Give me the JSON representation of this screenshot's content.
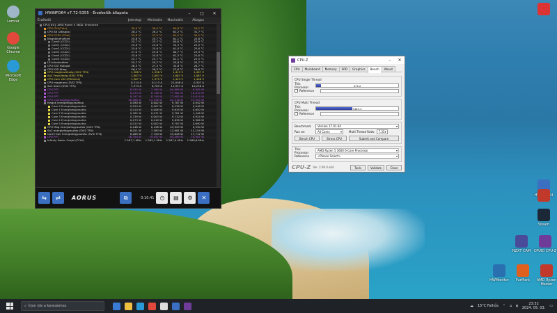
{
  "desktop": {
    "left_icons": [
      {
        "label": "Lomtár",
        "color": "#9fb6c8"
      },
      {
        "label": "Google Chrome",
        "color": "#e0493b"
      },
      {
        "label": "Microsoft Edge",
        "color": "#2a9ad6"
      }
    ],
    "right_icons": [
      {
        "label": "",
        "color": "#d33"
      },
      {
        "label": "HWiNFO64",
        "color": "#3b6fc1"
      },
      {
        "label": "",
        "color": "#c0392b"
      },
      {
        "label": "Steam",
        "color": "#1b2838"
      },
      {
        "label": "NZXT CAM",
        "color": "#4a4a9a"
      },
      {
        "label": "CPUID CPU-Z",
        "color": "#6f3c9a"
      },
      {
        "label": "HWMonitor",
        "color": "#2a6fb0"
      },
      {
        "label": "FurMark",
        "color": "#e06020"
      },
      {
        "label": "AMD Ryzen Master",
        "color": "#c0392b"
      }
    ]
  },
  "hwinfo": {
    "title": "HWiNFO64 v7.72-5355 - Érzékelők állapota",
    "columns": [
      "Érzékelő",
      "Jelenlegi",
      "Minimális",
      "Maximális",
      "Átlagos"
    ],
    "rows": [
      {
        "name": "CPU [#0]: AMD Ryzen 5 3600: Enhanced",
        "v": [
          "",
          "",
          "",
          ""
        ],
        "lvl": 0,
        "color": "#dddddd",
        "mk": "#888888"
      },
      {
        "name": "CPU (Tctl/Tdie)",
        "v": [
          "30,9 °C",
          "30,9 °C",
          "60,8 °C",
          "34,2 °C"
        ],
        "lvl": 1,
        "color": "#e0a030",
        "mk": "#e0a030"
      },
      {
        "name": "CPU Átl (Átlagos)",
        "v": [
          "28,2 °C",
          "28,2 °C",
          "61,2 °C",
          "31,7 °C"
        ],
        "lvl": 1,
        "color": "#dddddd",
        "mk": "#888888"
      },
      {
        "name": "CPU CCD1 (Tdie)",
        "v": [
          "32,8 °C",
          "27,5 °C",
          "61,5 °C",
          "35,2 °C"
        ],
        "lvl": 1,
        "color": "#e0a030",
        "mk": "#e0a030"
      },
      {
        "name": "Maghőmérséklet",
        "v": [
          "25,8 °C",
          "25,7 °C",
          "61,1 °C",
          "25,8 °C"
        ],
        "lvl": 1,
        "color": "#dddddd",
        "mk": "#888888"
      },
      {
        "name": "Core0 (CCD1)",
        "v": [
          "25,7 °C",
          "25,7 °C",
          "60,6 °C",
          "25,9 °C"
        ],
        "lvl": 2,
        "color": "#cccccc",
        "mk": "#777777"
      },
      {
        "name": "Core1 (CCD1)",
        "v": [
          "25,8 °C",
          "25,8 °C",
          "55,3 °C",
          "25,9 °C"
        ],
        "lvl": 2,
        "color": "#cccccc",
        "mk": "#777777"
      },
      {
        "name": "Core2 (CCD1)",
        "v": [
          "25,6 °C",
          "25,6 °C",
          "61,0 °C",
          "25,6 °C"
        ],
        "lvl": 2,
        "color": "#cccccc",
        "mk": "#777777"
      },
      {
        "name": "Core3 (CCD1)",
        "v": [
          "27,0 °C",
          "25,8 °C",
          "60,7 °C",
          "25,9 °C"
        ],
        "lvl": 2,
        "color": "#cccccc",
        "mk": "#777777"
      },
      {
        "name": "Core4 (CCD1)",
        "v": [
          "25,6 °C",
          "25,6 °C",
          "61,3 °C",
          "25,6 °C"
        ],
        "lvl": 2,
        "color": "#cccccc",
        "mk": "#777777"
      },
      {
        "name": "Core5 (CCD1)",
        "v": [
          "25,7 °C",
          "25,7 °C",
          "61,1 °C",
          "25,5 °C"
        ],
        "lvl": 2,
        "color": "#cccccc",
        "mk": "#777777"
      },
      {
        "name": "L3 hőmérséklet",
        "v": [
          "25,7 °C",
          "25,7 °C",
          "25,8 °C",
          "25,7 °C"
        ],
        "lvl": 1,
        "color": "#dddddd",
        "mk": "#888888"
      },
      {
        "name": "CPU IOD Hotspot",
        "v": [
          "28,3 °C",
          "27,5 °C",
          "32,8 °C",
          "28,7 °C"
        ],
        "lvl": 1,
        "color": "#dddddd",
        "mk": "#888888"
      },
      {
        "name": "CPU IOD Átlag",
        "v": [
          "26,4 °C",
          "26,3 °C",
          "27,6 °C",
          "26,6 °C"
        ],
        "lvl": 1,
        "color": "#dddddd",
        "mk": "#888888"
      },
      {
        "name": "CPU magfeszültség (SVI2 TFN)",
        "v": [
          "1,388 V",
          "1,356 V",
          "1,413 V",
          "1,407 V"
        ],
        "lvl": 1,
        "color": "#e6d84a",
        "mk": "#e6d84a"
      },
      {
        "name": "SoC Feszültség (SVI2 TFN)",
        "v": [
          "1,087 V",
          "1,087 V",
          "1,087 V",
          "1,087 V"
        ],
        "lvl": 1,
        "color": "#e6d84a",
        "mk": "#e6d84a"
      },
      {
        "name": "CPU Core VID (Effective)",
        "v": [
          "1,387 V",
          "1,375 V",
          "1,425 V",
          "1,408 V"
        ],
        "lvl": 1,
        "color": "#e6d84a",
        "mk": "#e6d84a"
      },
      {
        "name": "CPU magáram (SVI2 TFN)",
        "v": [
          "0,214 A",
          "0,113 A",
          "21,008 A",
          "0,307 A"
        ],
        "lvl": 1,
        "color": "#dddddd",
        "mk": "#888888"
      },
      {
        "name": "SoC áram (SVI2 TFN)",
        "v": [
          "7,373 A",
          "6,785 A",
          "11,937 A",
          "10,236 A"
        ],
        "lvl": 1,
        "color": "#dddddd",
        "mk": "#888888"
      },
      {
        "name": "CPU PPT",
        "v": [
          "8,255 W",
          "7,760 W",
          "64,889 W",
          "8,905 W"
        ],
        "lvl": 1,
        "color": "#b05adb",
        "mk": "#b05adb"
      },
      {
        "name": "CPU PPT",
        "v": [
          "8,253 W",
          "8,748 W",
          "77,982 W",
          "10,614 W"
        ],
        "lvl": 1,
        "color": "#b05adb",
        "mk": "#b05adb"
      },
      {
        "name": "CPU PPT",
        "v": [
          "8,247 W",
          "8,748 W",
          "77,982 W",
          "10,614 W"
        ],
        "lvl": 1,
        "color": "#b05adb",
        "mk": "#b05adb"
      },
      {
        "name": "CPU Csomagfogyasztás",
        "v": [
          "36,086 W",
          "23,536 W",
          "81,516 W",
          "23,954 W"
        ],
        "lvl": 1,
        "color": "#b05adb",
        "mk": "#b05adb"
      },
      {
        "name": "Magok energiafogyasztása",
        "v": [
          "0,090 W",
          "0,002 W",
          "9,787 W",
          "0,942 W"
        ],
        "lvl": 1,
        "color": "#dddddd",
        "mk": "#888888"
      },
      {
        "name": "Core 0 Energiafogyasztás",
        "v": [
          "0,024 W",
          "0,007 W",
          "8,536 W",
          "0,946 W"
        ],
        "lvl": 2,
        "color": "#cccccc",
        "mk": "#e6d84a"
      },
      {
        "name": "Core 1 Energiafogyasztás",
        "v": [
          "0,010 W",
          "0,006 W",
          "9,634 W",
          "0,650 W"
        ],
        "lvl": 2,
        "color": "#cccccc",
        "mk": "#e6d84a"
      },
      {
        "name": "Core 2 Energiafogyasztás",
        "v": [
          "0,182 W",
          "0,071 W",
          "9,781 W",
          "1,446 W"
        ],
        "lvl": 2,
        "color": "#cccccc",
        "mk": "#e6d84a"
      },
      {
        "name": "Core 3 Energiafogyasztás",
        "v": [
          "0,239 W",
          "0,003 W",
          "9,710 W",
          "0,924 W"
        ],
        "lvl": 2,
        "color": "#cccccc",
        "mk": "#e6d84a"
      },
      {
        "name": "Core 4 Energiafogyasztás",
        "v": [
          "0,073 W",
          "0,018 W",
          "9,638 W",
          "0,966 W"
        ],
        "lvl": 2,
        "color": "#cccccc",
        "mk": "#e6d84a"
      },
      {
        "name": "Core 5 Energiafogyasztás",
        "v": [
          "0,012 W",
          "0,002 W",
          "9,787 W",
          "0,690 W"
        ],
        "lvl": 2,
        "color": "#cccccc",
        "mk": "#e6d84a"
      },
      {
        "name": "CPU Mag energiafogyasztás (SVI2 TFN)",
        "v": [
          "0,248 W",
          "0,126 W",
          "43,929 W",
          "0,330 W"
        ],
        "lvl": 1,
        "color": "#dddddd",
        "mk": "#e6d84a"
      },
      {
        "name": "SoC energiafogyasztás (SVI2 TFN)",
        "v": [
          "8,021 W",
          "7,383 W",
          "12,981 W",
          "11,154 W"
        ],
        "lvl": 1,
        "color": "#dddddd",
        "mk": "#e6d84a"
      },
      {
        "name": "Core+SoC Energiafogyasztás (SVI2 TFN)",
        "v": [
          "8,269 W",
          "7,720 W",
          "55,828 W",
          "17,712 W"
        ],
        "lvl": 1,
        "color": "#dddddd",
        "mk": "#e6d84a"
      },
      {
        "name": "CPU PPT",
        "v": [
          "16,350 W",
          "19,052 W",
          "64,489 W",
          "16,907 W"
        ],
        "lvl": 1,
        "color": "#b05adb",
        "mk": "#b05adb"
      },
      {
        "name": "Infinity Fabric Órajel (FCLK)",
        "v": [
          "1.567,1 MHz",
          "1.562,1 MHz",
          "1.567,4 MHz",
          "1.566,6 MHz"
        ],
        "lvl": 1,
        "color": "#dddddd",
        "mk": "#888888"
      }
    ],
    "time": "0:10:41"
  },
  "cpuz": {
    "title": "CPU-Z",
    "tabs": [
      "CPU",
      "Mainboard",
      "Memory",
      "SPD",
      "Graphics",
      "Bench",
      "About"
    ],
    "active_tab": "Bench",
    "single": {
      "heading": "CPU Single Thread",
      "this_label": "This Processor",
      "this_value": "474.2",
      "this_fill": 0.06,
      "ref_label": "Reference"
    },
    "multi": {
      "heading": "CPU Multi Thread",
      "this_label": "This Processor",
      "this_value": "3483.2",
      "this_fill": 0.44,
      "ref_label": "Reference"
    },
    "benchmark_label": "Benchmark",
    "benchmark_value": "Version 17.01.64",
    "runon_label": "Run on",
    "runon_value": "All Cores",
    "mtr_label": "Multi Thread Ratio",
    "mtr_value": "7.35",
    "bench_btn": "Bench CPU",
    "stress_btn": "Stress CPU",
    "submit_btn": "Submit and Compare",
    "proc_label": "This Processor",
    "proc_value": "AMD Ryzen 5 3600 6-Core Processor",
    "ref_label": "Reference",
    "ref_value": "<Please Select>",
    "logo": "CPU-Z",
    "version": "Ver. 2.09.0.x64",
    "tools_btn": "Tools",
    "validate_btn": "Validate",
    "close_btn": "Close"
  },
  "taskbar": {
    "search_placeholder": "Írjon ide a kereséshez",
    "apps": [
      "#3a7bd5",
      "#f0c040",
      "#2a9ad6",
      "#e0493b",
      "#dddddd",
      "#3b6fc1",
      "#6f3c9a"
    ],
    "weather": "15°C Felhős",
    "time": "23:32",
    "date": "2024. 05. 03."
  }
}
